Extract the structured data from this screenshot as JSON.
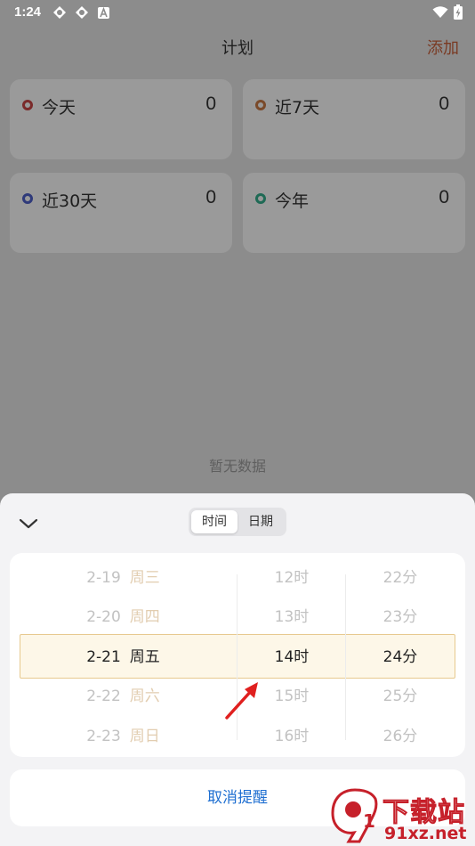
{
  "status_bar": {
    "time": "1:24",
    "left_icons": [
      "sync-icon",
      "sync-icon",
      "a-badge-icon"
    ],
    "right_icons": [
      "wifi-icon",
      "battery-charging-icon"
    ]
  },
  "header": {
    "title": "计划",
    "add_label": "添加"
  },
  "cards": [
    {
      "label": "今天",
      "count": "0",
      "color": "#7a2a2a"
    },
    {
      "label": "近7天",
      "count": "0",
      "color": "#7a4a2a"
    },
    {
      "label": "近30天",
      "count": "0",
      "color": "#2f3a7a"
    },
    {
      "label": "今年",
      "count": "0",
      "color": "#1f6a55"
    }
  ],
  "empty_text": "暂无数据",
  "sheet": {
    "tabs": [
      {
        "label": "时间",
        "active": true
      },
      {
        "label": "日期",
        "active": false
      }
    ],
    "picker": {
      "dates": [
        {
          "date": "2-19",
          "weekday": "周三"
        },
        {
          "date": "2-20",
          "weekday": "周四"
        },
        {
          "date": "2-21",
          "weekday": "周五"
        },
        {
          "date": "2-22",
          "weekday": "周六"
        },
        {
          "date": "2-23",
          "weekday": "周日"
        }
      ],
      "hours": [
        "12时",
        "13时",
        "14时",
        "15时",
        "16时"
      ],
      "minutes": [
        "22分",
        "23分",
        "24分",
        "25分",
        "26分"
      ],
      "selected_index": 2
    },
    "cancel_label": "取消提醒"
  },
  "watermark": {
    "top": "下载站",
    "bottom": "91xz.net"
  },
  "colors": {
    "accent_blue": "#1f6fd1",
    "highlight_bg": "#fdf7e8",
    "highlight_border": "#e7c98f",
    "watermark_red": "#c6202a"
  }
}
